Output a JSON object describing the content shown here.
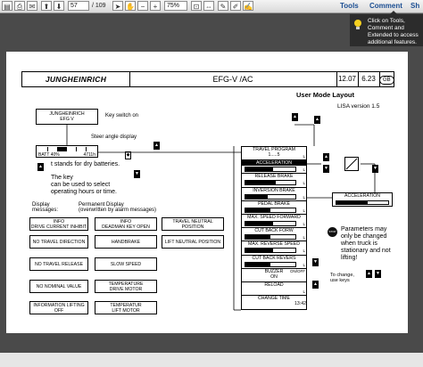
{
  "toolbar": {
    "page_current": "57",
    "page_total": "/ 109",
    "zoom": "75%",
    "tools_label": "Tools",
    "comment_label": "Comment",
    "share_label": "Sh"
  },
  "tooltip": {
    "text": "Click on Tools, Comment and Extended to access additional features."
  },
  "doc": {
    "brand": "JUNGHEINRICH",
    "model": "EFG-V /AC",
    "date": "12.07",
    "version": "6.23",
    "lang": "GB",
    "title": "User Mode Layout",
    "lisa": "LISA version 1.5",
    "start_box_line1": "JUNGHEINRICH",
    "start_box_line2": "EFG V",
    "key_switch": "Key switch on",
    "steer_angle": "Steer angle display",
    "batt": "BATT 40%",
    "hours": "4711h",
    "dry_batteries": "t stands for dry batteries.",
    "key_text": "The key\ncan be used to select\noperating hours or time.",
    "display_label": "Display\nmessages:",
    "permanent_label": "Permanent Display\n(overwritten by alarm messages)",
    "messages": [
      {
        "line1": "INFO",
        "line2": "DRIVE CURRENT INHIBIT"
      },
      {
        "line1": "INFO",
        "line2": "DEADMAN KEY OPEN"
      },
      {
        "line1": "TRAVEL NEUTRAL",
        "line2": "POSITION"
      },
      {
        "line1": "NO TRAVEL DIRECTION",
        "line2": ""
      },
      {
        "line1": "HANDBRAKE",
        "line2": ""
      },
      {
        "line1": "LIFT NEUTRAL POSITION",
        "line2": ""
      },
      {
        "line1": "NO TRAVEL RELEASE",
        "line2": ""
      },
      {
        "line1": "SLOW SPEED",
        "line2": ""
      },
      {
        "line1": "",
        "line2": ""
      },
      {
        "line1": "NO NOMINAL VALUE",
        "line2": ""
      },
      {
        "line1": "TEMPERATURE",
        "line2": "DRIVE MOTOR"
      },
      {
        "line1": "",
        "line2": ""
      },
      {
        "line1": "INFORMATION LIFTING",
        "line2": "OFF"
      },
      {
        "line1": "TEMPERATUR",
        "line2": "LIFT MOTOR"
      }
    ],
    "menu": [
      {
        "label": "TRAVEL PROGRAM",
        "sub": "1.....5",
        "flag": "L",
        "bar": 0
      },
      {
        "label": "ACCELERATION",
        "sub": "",
        "flag": "L",
        "bar": 0.55
      },
      {
        "label": "RELEASE BRAKE",
        "sub": "",
        "flag": "L",
        "bar": 0.6
      },
      {
        "label": "INVERSION BRAKE",
        "sub": "",
        "flag": "L",
        "bar": 0.45
      },
      {
        "label": "PEDAL BRAKE",
        "sub": "",
        "flag": "L",
        "bar": 0.5
      },
      {
        "label": "MAX. SPEED FORWARD",
        "sub": "",
        "flag": "L",
        "bar": 0.55
      },
      {
        "label": "CUT BACK FORW",
        "sub": "",
        "flag": "L",
        "bar": 0.5
      },
      {
        "label": "MAX. REVERSE SPEED",
        "sub": "",
        "flag": "L",
        "bar": 0.55
      },
      {
        "label": "CUT BACK REVERS",
        "sub": "",
        "flag": "L",
        "bar": 0.5
      },
      {
        "label": "BUZZER",
        "sub": "ON",
        "flag": "ON/OFF",
        "bar": 0
      },
      {
        "label": "RELOAD",
        "sub": "",
        "flag": "L",
        "bar": 0
      },
      {
        "label": "CHANGE TIME",
        "sub": "13:42",
        "flag": "",
        "bar": 0
      }
    ],
    "accel_box": "ACCELERATION",
    "params_note": "Parameters may\nonly be changed\nwhen truck is\nstationary and not\nlifting!",
    "change_note": "To change,\nuse keys",
    "stop_label": "STOP"
  }
}
